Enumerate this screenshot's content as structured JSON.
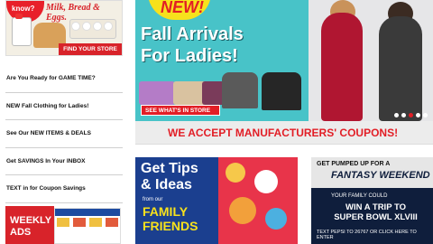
{
  "promo": {
    "badge_text": "know?",
    "headline": "Milk, Bread & Eggs.",
    "cta": "FIND YOUR STORE"
  },
  "nav": {
    "items": [
      {
        "label": "Are You Ready for GAME TIME?"
      },
      {
        "label": "NEW Fall Clothing for Ladies!"
      },
      {
        "label": "See Our NEW ITEMS & DEALS"
      },
      {
        "label": "Get SAVINGS In Your INBOX"
      },
      {
        "label": "TEXT in for Coupon Savings"
      }
    ]
  },
  "weekly": {
    "label_line1": "WEEKLY",
    "label_line2": "ADS"
  },
  "hero": {
    "burst": "NEW!",
    "title_line1": "Fall Arrivals",
    "title_line2": "For Ladies!",
    "cta": "SEE WHAT'S IN STORE"
  },
  "coupons": {
    "text": "WE ACCEPT MANUFACTURERS' COUPONS!"
  },
  "tips": {
    "line1": "Get Tips",
    "line2": "& Ideas",
    "from": "from our",
    "line3": "FAMILY",
    "line4": "FRIENDS"
  },
  "fantasy": {
    "line1": "GET PUMPED UP FOR A",
    "line2": "FANTASY WEEKEND",
    "line3": "YOUR FAMILY COULD",
    "line4": "WIN A TRIP TO",
    "line5": "SUPER BOWL XLVIII",
    "line6": "TEXT PEPSI TO 26767 OR CLICK HERE TO ENTER"
  },
  "colors": {
    "brand_red": "#e21e26",
    "hero_teal": "#48c3c8",
    "navy": "#1b3f8f"
  }
}
